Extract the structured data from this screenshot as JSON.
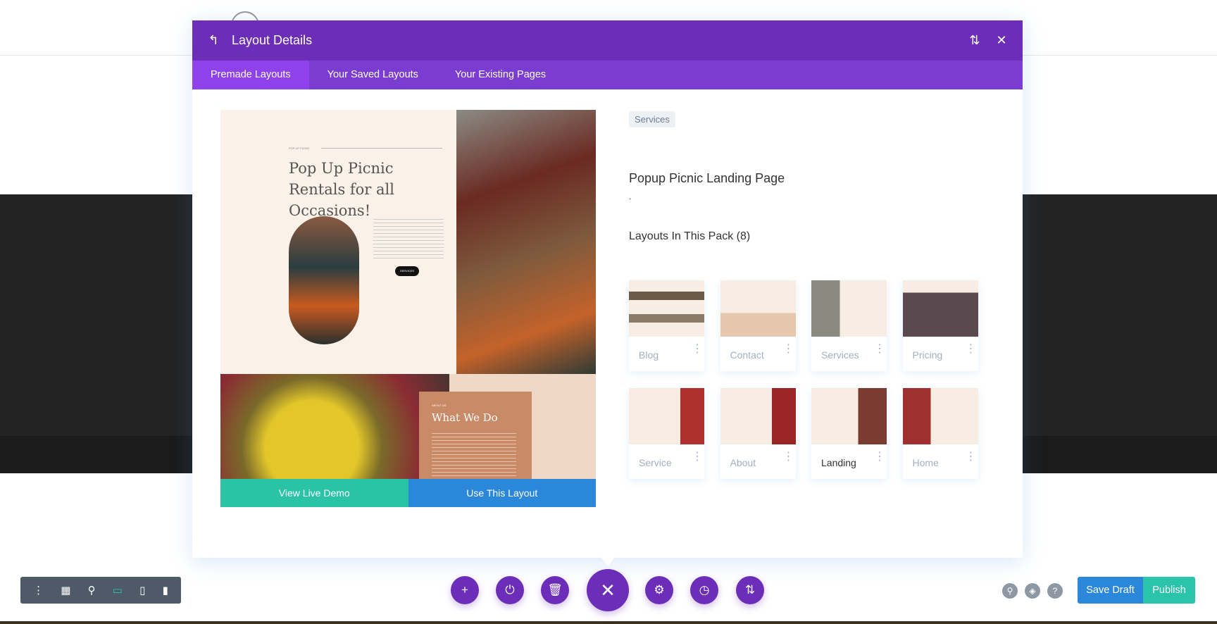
{
  "modal": {
    "title": "Layout Details",
    "tabs": [
      "Premade Layouts",
      "Your Saved Layouts",
      "Your Existing Pages"
    ]
  },
  "preview": {
    "kicker": "POP UP PICNIC",
    "heading": "Pop Up Picnic Rentals for all Occasions!",
    "button": "SERVICES",
    "about_kicker": "ABOUT US",
    "about_heading": "What We Do",
    "demo_label": "View Live Demo",
    "use_label": "Use This Layout"
  },
  "details": {
    "category": "Services",
    "title": "Popup Picnic Landing Page",
    "description": ".",
    "pack_heading": "Layouts In This Pack (8)",
    "layouts": [
      {
        "name": "Blog"
      },
      {
        "name": "Contact"
      },
      {
        "name": "Services"
      },
      {
        "name": "Pricing"
      },
      {
        "name": "Service"
      },
      {
        "name": "About"
      },
      {
        "name": "Landing",
        "selected": true
      },
      {
        "name": "Home"
      }
    ]
  },
  "footer": {
    "save_draft": "Save Draft",
    "publish": "Publish"
  },
  "colors": {
    "purple": "#6c2eb9",
    "tab": "#7b3dd1",
    "blue": "#2b87da",
    "teal": "#29c4a9"
  }
}
